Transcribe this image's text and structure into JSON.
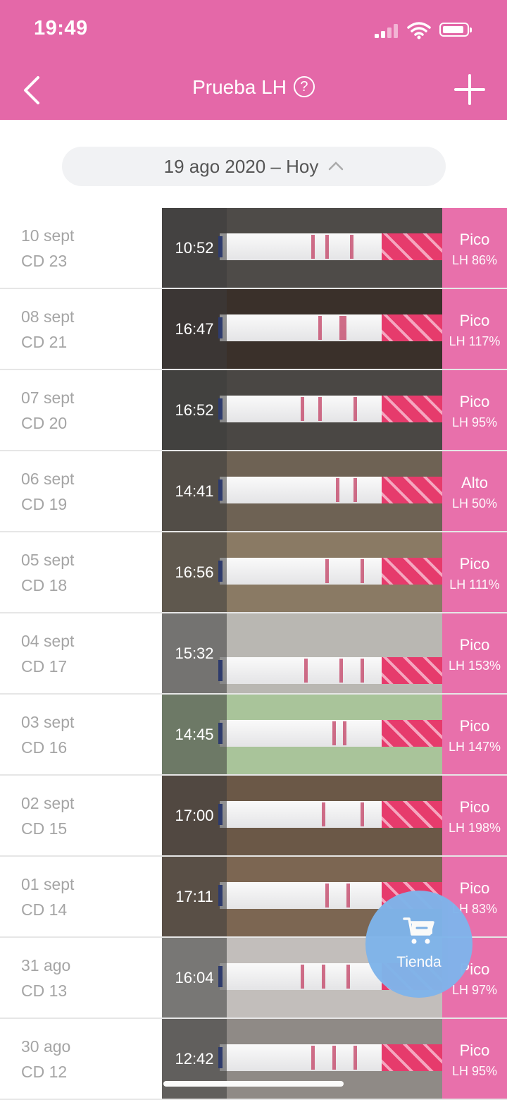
{
  "status_bar": {
    "time": "19:49"
  },
  "header": {
    "title": "Prueba LH",
    "help_symbol": "?"
  },
  "range": {
    "label": "19 ago 2020 – Hoy"
  },
  "colors": {
    "brand_pink": "#e468a8",
    "result_pink": "#e870ab",
    "shop_blue": "#7fb4ea"
  },
  "entries": [
    {
      "date": "10 sept",
      "cd": "CD 23",
      "time": "10:52",
      "status": "Pico",
      "lh": "LH 86%",
      "bg": "#4e4b48"
    },
    {
      "date": "08 sept",
      "cd": "CD 21",
      "time": "16:47",
      "status": "Pico",
      "lh": "LH 117%",
      "bg": "#3a302a"
    },
    {
      "date": "07 sept",
      "cd": "CD 20",
      "time": "16:52",
      "status": "Pico",
      "lh": "LH 95%",
      "bg": "#4a4744"
    },
    {
      "date": "06 sept",
      "cd": "CD 19",
      "time": "14:41",
      "status": "Alto",
      "lh": "LH 50%",
      "bg": "#6e6254"
    },
    {
      "date": "05 sept",
      "cd": "CD 18",
      "time": "16:56",
      "status": "Pico",
      "lh": "LH 111%",
      "bg": "#8a7a64"
    },
    {
      "date": "04 sept",
      "cd": "CD 17",
      "time": "15:32",
      "status": "Pico",
      "lh": "LH 153%",
      "bg": "#b9b7b2"
    },
    {
      "date": "03 sept",
      "cd": "CD 16",
      "time": "14:45",
      "status": "Pico",
      "lh": "LH 147%",
      "bg": "#a9c49a"
    },
    {
      "date": "02 sept",
      "cd": "CD 15",
      "time": "17:00",
      "status": "Pico",
      "lh": "LH 198%",
      "bg": "#6b5847"
    },
    {
      "date": "01 sept",
      "cd": "CD 14",
      "time": "17:11",
      "status": "Pico",
      "lh": "LH 83%",
      "bg": "#7c6652"
    },
    {
      "date": "31 ago",
      "cd": "CD 13",
      "time": "16:04",
      "status": "Pico",
      "lh": "LH 97%",
      "bg": "#c2bebb"
    },
    {
      "date": "30 ago",
      "cd": "CD 12",
      "time": "12:42",
      "status": "Pico",
      "lh": "LH 95%",
      "bg": "#8f8a86"
    }
  ],
  "shop": {
    "label": "Tienda",
    "icon": "cart-icon"
  }
}
